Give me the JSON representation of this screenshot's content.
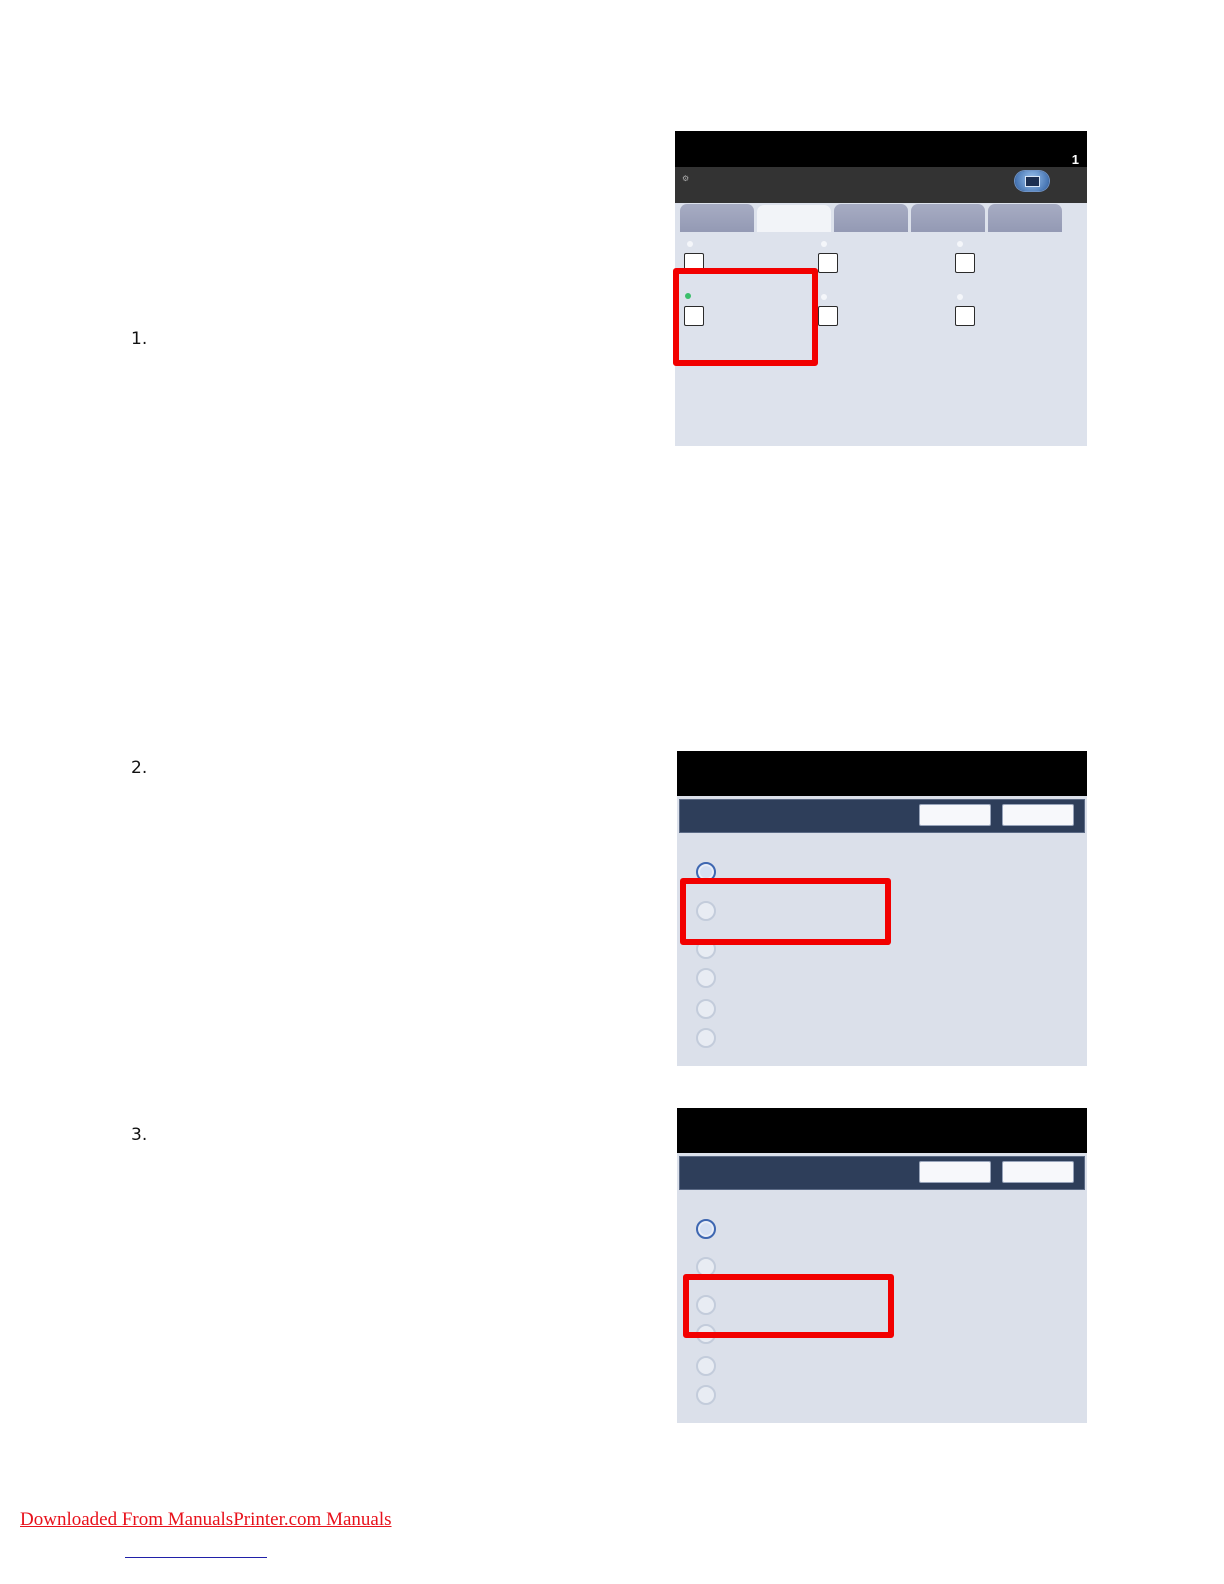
{
  "steps": [
    "1.",
    "2.",
    "3."
  ],
  "screen1": {
    "copy_count": "1",
    "indicator_text": "⚙",
    "tabs": 5,
    "active_tab": 2
  },
  "screen2": {
    "selected_option": 1,
    "option_count": 6
  },
  "screen3": {
    "selected_option": 1,
    "option_count": 6
  },
  "footer": {
    "link_text": "Downloaded From ManualsPrinter.com Manuals"
  },
  "colors": {
    "highlight": "#f20000",
    "link": "#e8111b",
    "screen_bg": "#dde2ec"
  }
}
